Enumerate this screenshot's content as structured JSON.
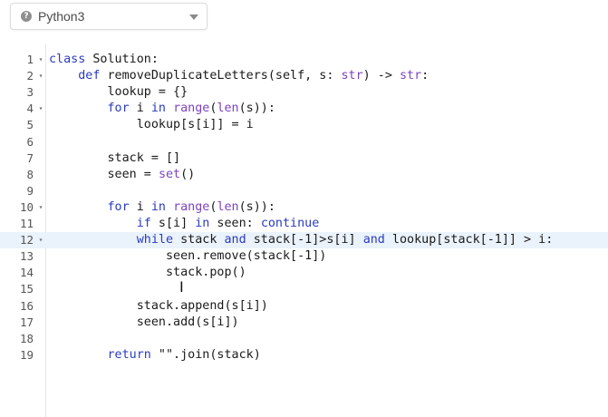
{
  "language_selector": {
    "label": "Python3",
    "icon": "info-circle-icon"
  },
  "colors": {
    "keyword": "#2a3cbd",
    "builtin": "#7d43bd",
    "active_line": "#eaf2fb"
  },
  "editor": {
    "active_line": 12,
    "lines": [
      {
        "num": "1",
        "fold": true,
        "tokens": [
          [
            "kw",
            "class"
          ],
          [
            "t",
            " Solution:"
          ]
        ]
      },
      {
        "num": "2",
        "fold": true,
        "tokens": [
          [
            "t",
            "    "
          ],
          [
            "kw",
            "def"
          ],
          [
            "t",
            " removeDuplicateLetters(self, s: "
          ],
          [
            "ty",
            "str"
          ],
          [
            "t",
            ") -> "
          ],
          [
            "ty",
            "str"
          ],
          [
            "t",
            ":"
          ]
        ]
      },
      {
        "num": "3",
        "fold": false,
        "tokens": [
          [
            "t",
            "        lookup = {}"
          ]
        ]
      },
      {
        "num": "4",
        "fold": true,
        "tokens": [
          [
            "t",
            "        "
          ],
          [
            "kw",
            "for"
          ],
          [
            "t",
            " i "
          ],
          [
            "kw",
            "in"
          ],
          [
            "t",
            " "
          ],
          [
            "bi",
            "range"
          ],
          [
            "t",
            "("
          ],
          [
            "bi",
            "len"
          ],
          [
            "t",
            "(s)):"
          ]
        ]
      },
      {
        "num": "5",
        "fold": false,
        "tokens": [
          [
            "t",
            "            lookup[s[i]] = i"
          ]
        ]
      },
      {
        "num": "6",
        "fold": false,
        "tokens": []
      },
      {
        "num": "7",
        "fold": false,
        "tokens": [
          [
            "t",
            "        stack = []"
          ]
        ]
      },
      {
        "num": "8",
        "fold": false,
        "tokens": [
          [
            "t",
            "        seen = "
          ],
          [
            "bi",
            "set"
          ],
          [
            "t",
            "()"
          ]
        ]
      },
      {
        "num": "9",
        "fold": false,
        "tokens": []
      },
      {
        "num": "10",
        "fold": true,
        "tokens": [
          [
            "t",
            "        "
          ],
          [
            "kw",
            "for"
          ],
          [
            "t",
            " i "
          ],
          [
            "kw",
            "in"
          ],
          [
            "t",
            " "
          ],
          [
            "bi",
            "range"
          ],
          [
            "t",
            "("
          ],
          [
            "bi",
            "len"
          ],
          [
            "t",
            "(s)):"
          ]
        ]
      },
      {
        "num": "11",
        "fold": false,
        "tokens": [
          [
            "t",
            "            "
          ],
          [
            "kw",
            "if"
          ],
          [
            "t",
            " s[i] "
          ],
          [
            "kw",
            "in"
          ],
          [
            "t",
            " seen: "
          ],
          [
            "kw",
            "continue"
          ]
        ]
      },
      {
        "num": "12",
        "fold": true,
        "tokens": [
          [
            "t",
            "            "
          ],
          [
            "kw",
            "while"
          ],
          [
            "t",
            " stack "
          ],
          [
            "kw",
            "and"
          ],
          [
            "t",
            " stack[-1]>s[i] "
          ],
          [
            "kw",
            "and"
          ],
          [
            "t",
            " lookup[stack[-1]] > i:"
          ]
        ]
      },
      {
        "num": "13",
        "fold": false,
        "tokens": [
          [
            "t",
            "                seen.remove(stack[-1])"
          ]
        ]
      },
      {
        "num": "14",
        "fold": false,
        "tokens": [
          [
            "t",
            "                stack.pop()"
          ]
        ]
      },
      {
        "num": "15",
        "fold": false,
        "tokens": []
      },
      {
        "num": "16",
        "fold": false,
        "tokens": [
          [
            "t",
            "            stack.append(s[i])"
          ]
        ]
      },
      {
        "num": "17",
        "fold": false,
        "tokens": [
          [
            "t",
            "            seen.add(s[i])"
          ]
        ]
      },
      {
        "num": "18",
        "fold": false,
        "tokens": []
      },
      {
        "num": "19",
        "fold": false,
        "tokens": [
          [
            "t",
            "        "
          ],
          [
            "kw",
            "return"
          ],
          [
            "t",
            " \"\".join(stack)"
          ]
        ]
      }
    ]
  }
}
